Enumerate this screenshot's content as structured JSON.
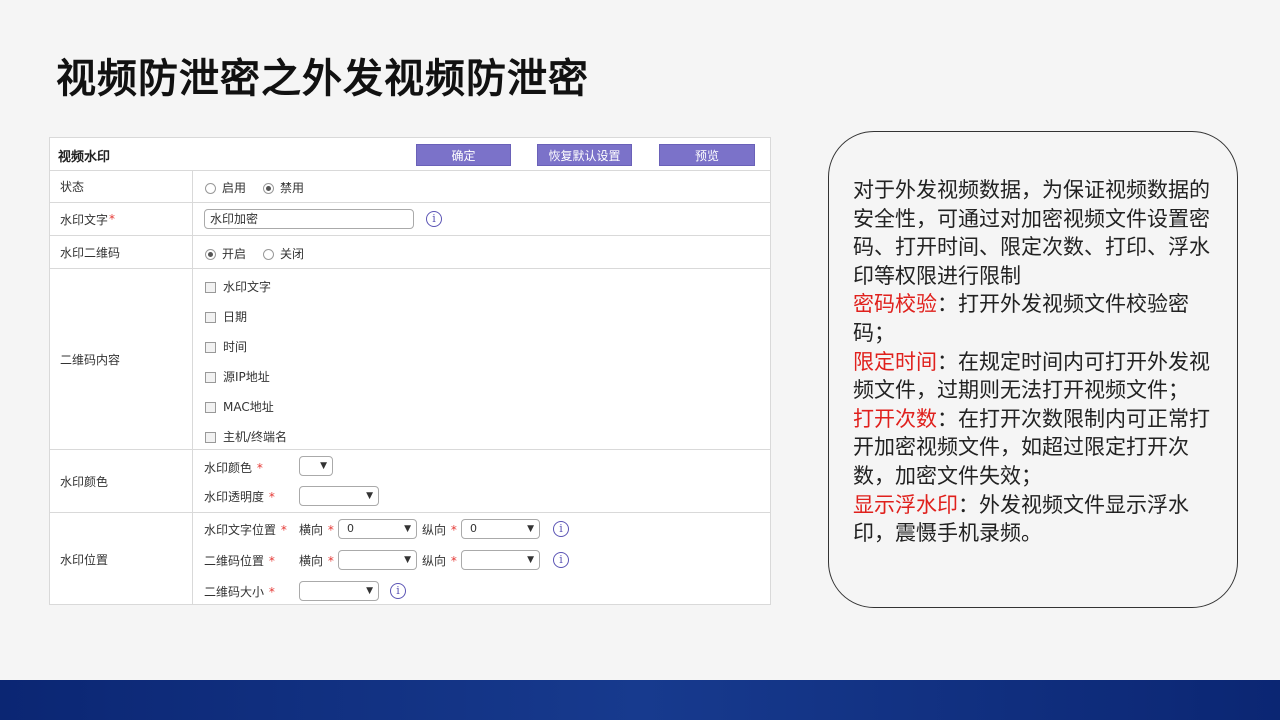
{
  "slide": {
    "title": "视频防泄密之外发视频防泄密"
  },
  "panel": {
    "title": "视频水印",
    "buttons": {
      "confirm": "确定",
      "reset": "恢复默认设置",
      "preview": "预览"
    },
    "status": {
      "label": "状态",
      "enable": "启用",
      "disable": "禁用",
      "selected": "禁用"
    },
    "watermark_text": {
      "label": "水印文字",
      "value": "水印加密"
    },
    "qr": {
      "label": "水印二维码",
      "on": "开启",
      "off": "关闭",
      "selected": "开启"
    },
    "qr_content": {
      "label": "二维码内容",
      "items": [
        "水印文字",
        "日期",
        "时间",
        "源IP地址",
        "MAC地址",
        "主机/终端名"
      ]
    },
    "color": {
      "label": "水印颜色",
      "color_label": "水印颜色",
      "opacity_label": "水印透明度"
    },
    "position": {
      "label": "水印位置",
      "text_pos_label": "水印文字位置",
      "qr_pos_label": "二维码位置",
      "qr_size_label": "二维码大小",
      "horizontal": "横向",
      "vertical": "纵向",
      "text_h_value": "0",
      "text_v_value": "0"
    },
    "required_mark": "*",
    "info_glyph": "i",
    "dropdown_glyph": "▼"
  },
  "note": {
    "intro": "对于外发视频数据，为保证视频数据的安全性，可通过对加密视频文件设置密码、打开时间、限定次数、打印、浮水印等权限进行限制",
    "items": [
      {
        "term": "密码校验",
        "desc": "：打开外发视频文件校验密码；"
      },
      {
        "term": "限定时间",
        "desc": "：在规定时间内可打开外发视频文件，过期则无法打开视频文件；"
      },
      {
        "term": "打开次数",
        "desc": "：在打开次数限制内可正常打开加密视频文件，如超过限定打开次数，加密文件失效；"
      },
      {
        "term": "显示浮水印",
        "desc": "：外发视频文件显示浮水印，震慑手机录频。"
      }
    ]
  },
  "colors": {
    "accent": "#7b72c9",
    "term_red": "#e0201c",
    "footer": "#0b2673"
  }
}
